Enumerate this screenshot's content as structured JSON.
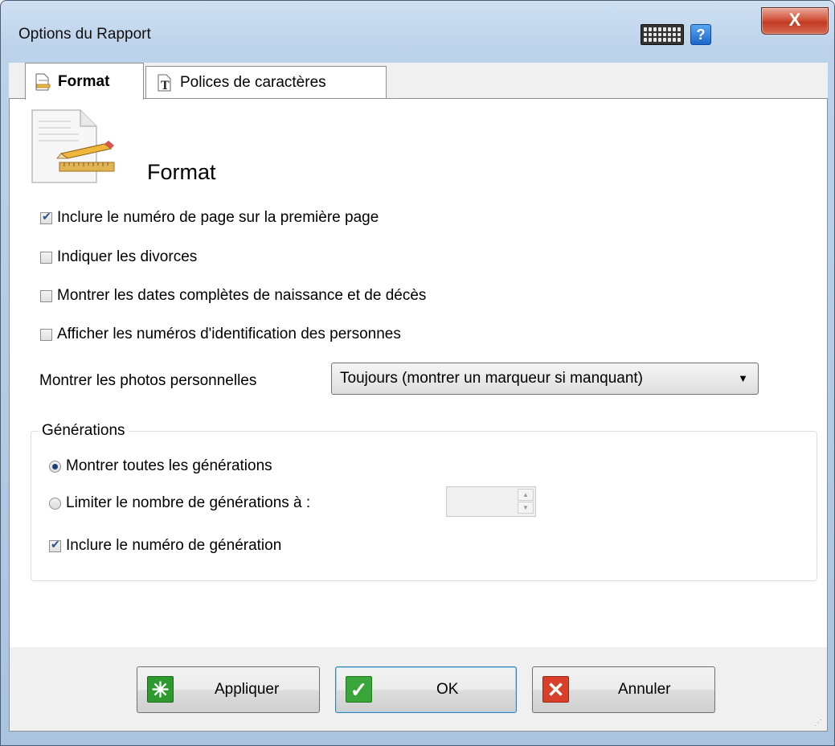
{
  "window": {
    "title": "Options du Rapport",
    "help_label": "?",
    "close_label": "X"
  },
  "tabs": [
    {
      "label": "Format",
      "active": true
    },
    {
      "label": "Polices de caractères",
      "active": false
    }
  ],
  "section": {
    "heading": "Format"
  },
  "options": [
    {
      "label": "Inclure le numéro de page sur la première page",
      "checked": true
    },
    {
      "label": "Indiquer les divorces",
      "checked": false
    },
    {
      "label": "Montrer les dates complètes de naissance et de décès",
      "checked": false
    },
    {
      "label": "Afficher les numéros d'identification des personnes",
      "checked": false
    }
  ],
  "photos": {
    "label": "Montrer les photos personnelles",
    "selected": "Toujours (montrer un marqueur si manquant)"
  },
  "generations": {
    "legend": "Générations",
    "all_label": "Montrer toutes les générations",
    "all_selected": true,
    "limit_label": "Limiter le nombre de générations à :",
    "limit_selected": false,
    "limit_value": "",
    "include_number_label": "Inclure le numéro de génération",
    "include_number_checked": true
  },
  "buttons": {
    "apply": "Appliquer",
    "ok": "OK",
    "cancel": "Annuler"
  },
  "colors": {
    "accent": "#2a4e8f",
    "apply_icon": "#2e9a2e",
    "ok_icon": "#3aa63a",
    "cancel_icon": "#d9402b"
  }
}
